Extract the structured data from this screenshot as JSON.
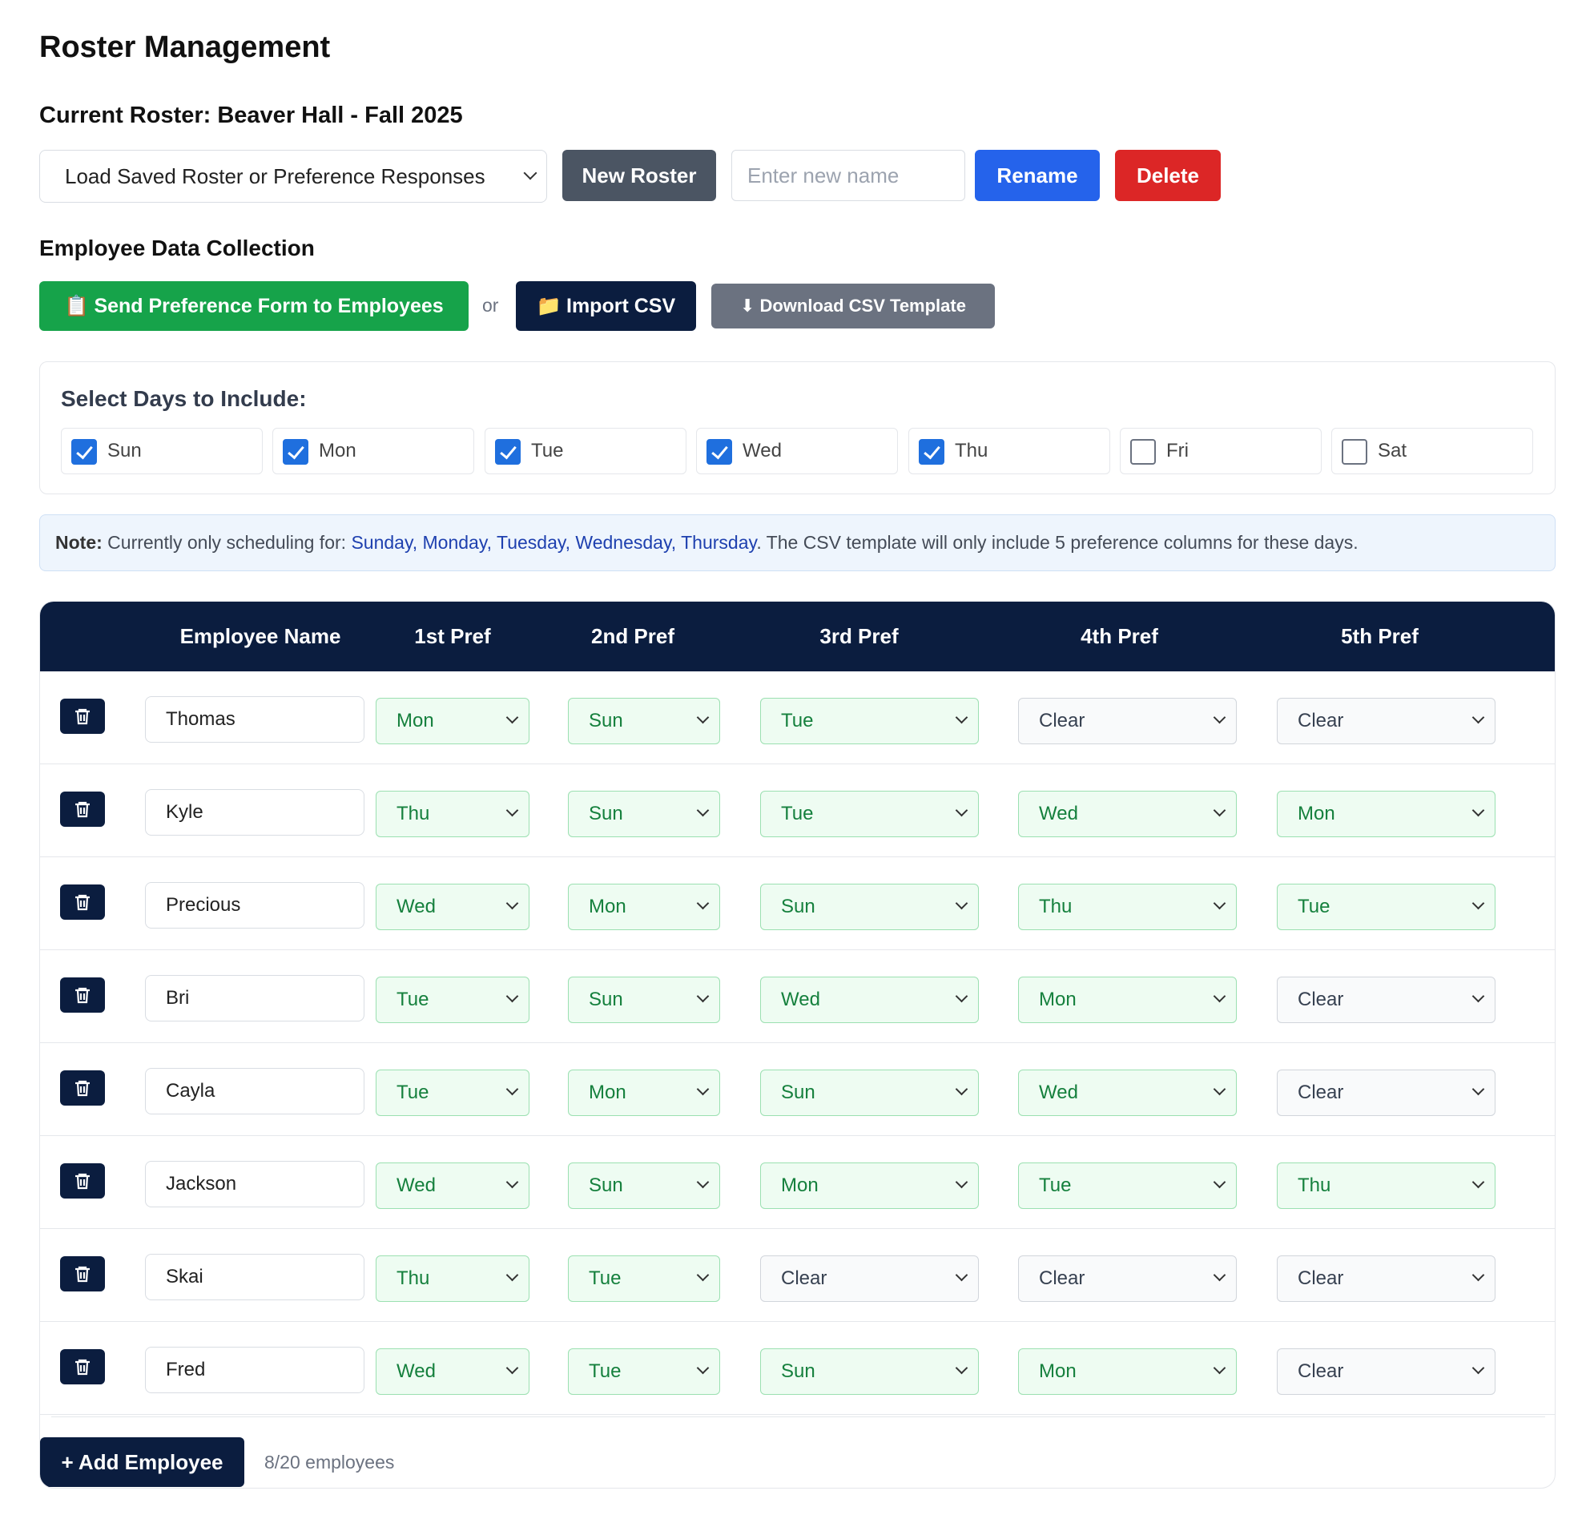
{
  "page": {
    "title": "Roster Management",
    "current_roster": "Current Roster: Beaver Hall - Fall 2025"
  },
  "roster_controls": {
    "load_select": "Load Saved Roster or Preference Responses",
    "new_roster": "New Roster",
    "name_placeholder": "Enter new name",
    "name_value": "",
    "rename": "Rename",
    "delete": "Delete"
  },
  "collection": {
    "title": "Employee Data Collection",
    "send_icon": "clipboard-icon",
    "send_glyph": "📋",
    "send": "Send Preference Form to Employees",
    "or": "or",
    "import_icon": "folder-icon",
    "import_glyph": "📁",
    "import": "Import CSV",
    "template_icon": "download-icon",
    "template_glyph": "⬇",
    "template": "Download CSV Template"
  },
  "days": {
    "title": "Select Days to Include:",
    "items": [
      {
        "label": "Sun",
        "checked": true
      },
      {
        "label": "Mon",
        "checked": true
      },
      {
        "label": "Tue",
        "checked": true
      },
      {
        "label": "Wed",
        "checked": true
      },
      {
        "label": "Thu",
        "checked": true
      },
      {
        "label": "Fri",
        "checked": false
      },
      {
        "label": "Sat",
        "checked": false
      }
    ]
  },
  "note": {
    "label": "Note:",
    "prefix": "Currently only scheduling for: ",
    "days": "Sunday, Monday, Tuesday, Wednesday, Thursday",
    "suffix": ". The CSV template will only include 5 preference columns for these days."
  },
  "table": {
    "headers": [
      "Employee Name",
      "1st Pref",
      "2nd Pref",
      "3rd Pref",
      "4th Pref",
      "5th Pref"
    ],
    "rows": [
      {
        "name": "Thomas",
        "prefs": [
          "Mon",
          "Sun",
          "Tue",
          "Clear",
          "Clear"
        ]
      },
      {
        "name": "Kyle",
        "prefs": [
          "Thu",
          "Sun",
          "Tue",
          "Wed",
          "Mon"
        ]
      },
      {
        "name": "Precious",
        "prefs": [
          "Wed",
          "Mon",
          "Sun",
          "Thu",
          "Tue"
        ]
      },
      {
        "name": "Bri",
        "prefs": [
          "Tue",
          "Sun",
          "Wed",
          "Mon",
          "Clear"
        ]
      },
      {
        "name": "Cayla",
        "prefs": [
          "Tue",
          "Mon",
          "Sun",
          "Wed",
          "Clear"
        ]
      },
      {
        "name": "Jackson",
        "prefs": [
          "Wed",
          "Sun",
          "Mon",
          "Tue",
          "Thu"
        ]
      },
      {
        "name": "Skai",
        "prefs": [
          "Thu",
          "Tue",
          "Clear",
          "Clear",
          "Clear"
        ]
      },
      {
        "name": "Fred",
        "prefs": [
          "Wed",
          "Tue",
          "Sun",
          "Mon",
          "Clear"
        ]
      }
    ]
  },
  "footer": {
    "add_employee": "+ Add Employee",
    "employee_count": "8/20 employees"
  },
  "colors": {
    "navy": "#0b1d3f",
    "green": "#16a34a",
    "blue": "#2563eb",
    "red": "#dc2626",
    "slate": "#4b5563"
  }
}
